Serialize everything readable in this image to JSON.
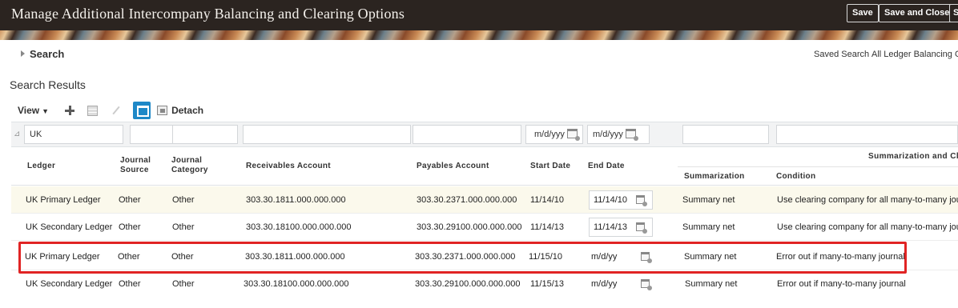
{
  "header": {
    "title": "Manage Additional Intercompany Balancing and Clearing Options",
    "save_label": "Save",
    "save_close_label": "Save and Close",
    "extra_label": "S"
  },
  "search": {
    "toggle_label": "Search",
    "saved_search_label": "Saved Search",
    "saved_search_value": "All Ledger Balancing Op"
  },
  "results": {
    "title": "Search Results"
  },
  "toolbar": {
    "view_label": "View",
    "detach_label": "Detach"
  },
  "filters": {
    "ledger": "UK",
    "start_date_placeholder": "m/d/yyy",
    "end_date_placeholder": "m/d/yyy"
  },
  "columns": {
    "ledger": "Ledger",
    "journal_source_1": "Journal",
    "journal_source_2": "Source",
    "journal_category_1": "Journal",
    "journal_category_2": "Category",
    "receivables": "Receivables Account",
    "payables": "Payables Account",
    "start_date": "Start Date",
    "end_date": "End Date",
    "group": "Summarization and Cl",
    "summarization": "Summarization",
    "condition": "Condition"
  },
  "rows": [
    {
      "ledger": "UK Primary Ledger",
      "source": "Other",
      "category": "Other",
      "receivables": "303.30.1811.000.000.000",
      "payables": "303.30.2371.000.000.000",
      "start": "11/14/10",
      "end": "11/14/10",
      "summarization": "Summary net",
      "condition": "Use clearing company for all many-to-many journals"
    },
    {
      "ledger": "UK Secondary Ledger",
      "source": "Other",
      "category": "Other",
      "receivables": "303.30.18100.000.000.000",
      "payables": "303.30.29100.000.000.000",
      "start": "11/14/13",
      "end": "11/14/13",
      "summarization": "Summary net",
      "condition": "Use clearing company for all many-to-many journals"
    },
    {
      "ledger": "UK Primary Ledger",
      "source": "Other",
      "category": "Other",
      "receivables": "303.30.1811.000.000.000",
      "payables": "303.30.2371.000.000.000",
      "start": "11/15/10",
      "end": "m/d/yy",
      "summarization": "Summary net",
      "condition": "Error out if many-to-many journal"
    },
    {
      "ledger": "UK Secondary Ledger",
      "source": "Other",
      "category": "Other",
      "receivables": "303.30.18100.000.000.000",
      "payables": "303.30.29100.000.000.000",
      "start": "11/15/13",
      "end": "m/d/yy",
      "summarization": "Summary net",
      "condition": "Error out if many-to-many journal"
    }
  ],
  "colors": {
    "header_bg": "#2b2420",
    "accent": "#1e88c7",
    "highlight_box": "#e02424",
    "selected_row": "#fbf9ec"
  }
}
